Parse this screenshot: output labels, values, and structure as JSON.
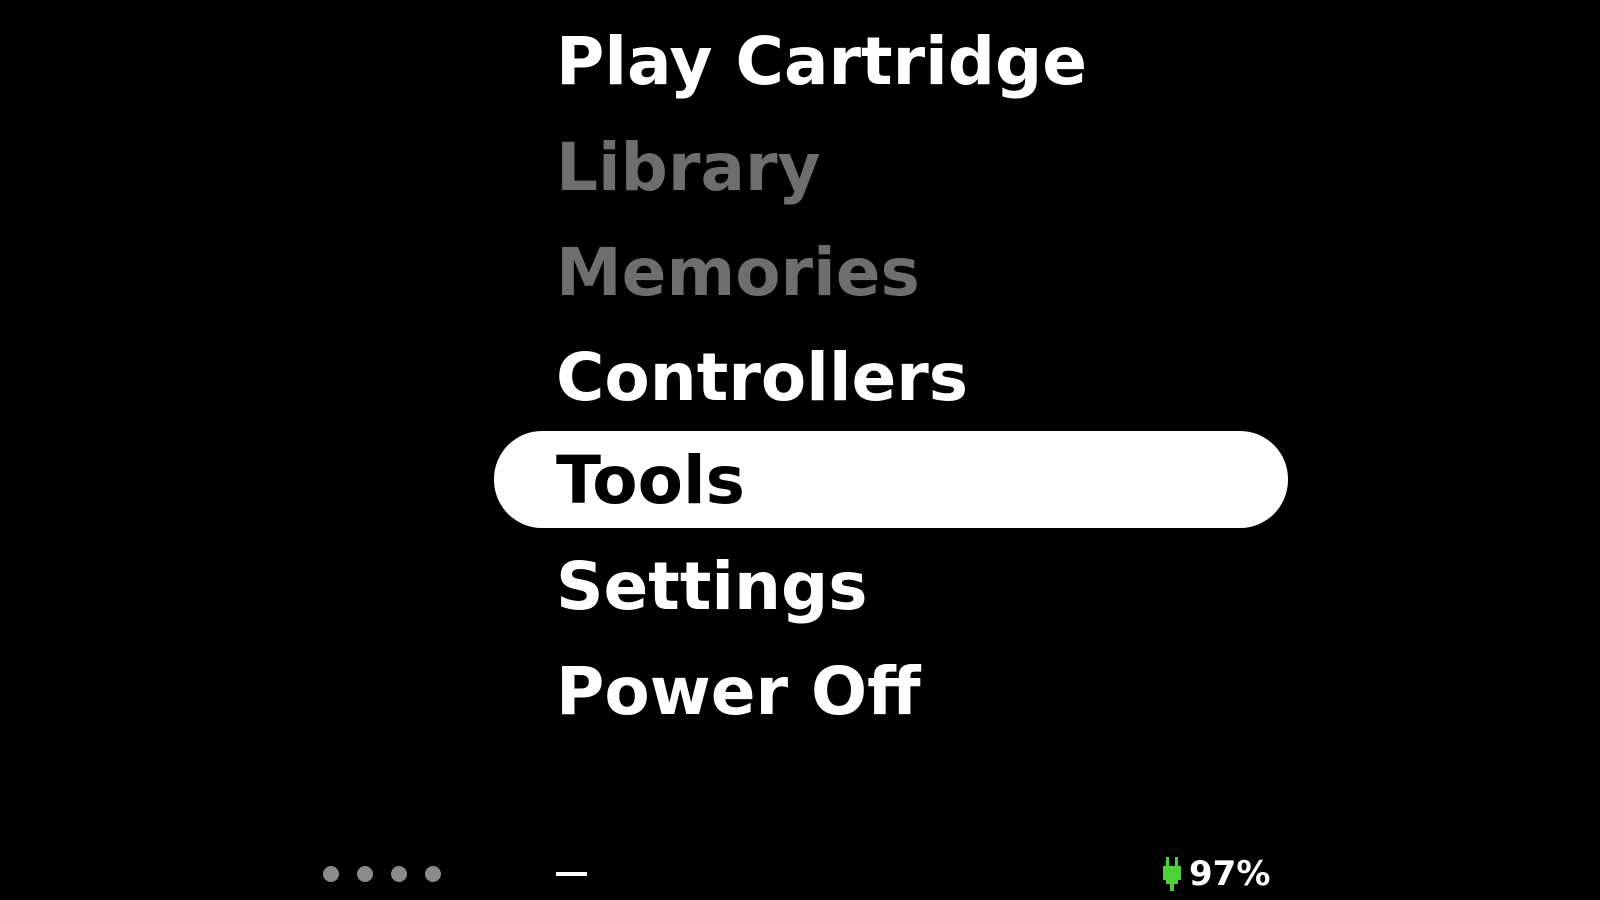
{
  "menu": {
    "items": [
      {
        "label": "Play Cartridge",
        "state": "enabled"
      },
      {
        "label": "Library",
        "state": "disabled"
      },
      {
        "label": "Memories",
        "state": "disabled"
      },
      {
        "label": "Controllers",
        "state": "enabled"
      },
      {
        "label": "Tools",
        "state": "selected"
      },
      {
        "label": "Settings",
        "state": "enabled"
      },
      {
        "label": "Power Off",
        "state": "enabled"
      }
    ]
  },
  "footer": {
    "page_dots_count": 4,
    "status_dash": "—",
    "battery_percent": "97%",
    "battery_icon": "plug-icon",
    "battery_icon_color": "#4cd137"
  },
  "colors": {
    "background": "#000000",
    "text": "#ffffff",
    "disabled_text": "#6e6e6e",
    "selection": "#ffffff"
  }
}
